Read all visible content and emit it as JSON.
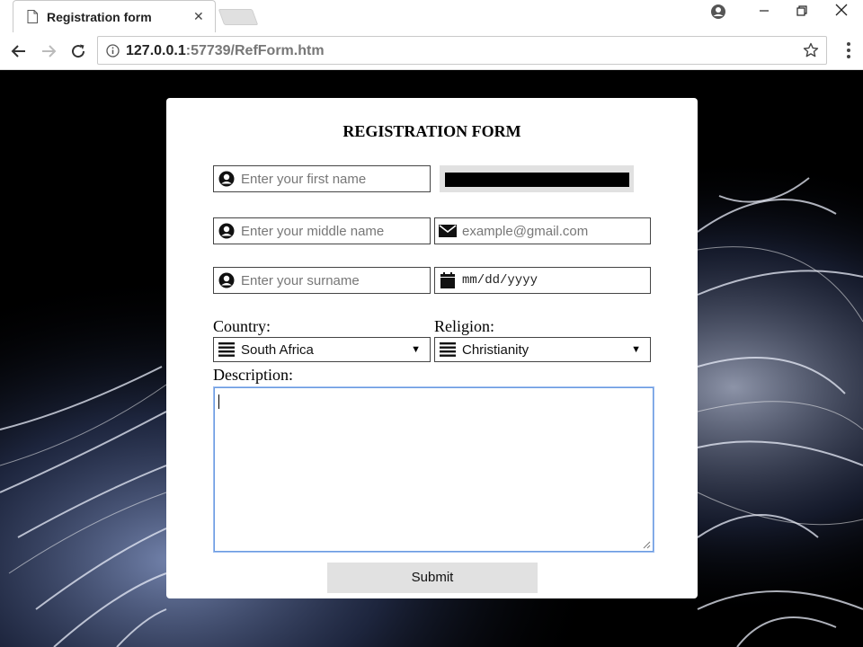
{
  "browser": {
    "tab_title": "Registration form",
    "url_host": "127.0.0.1",
    "url_rest": ":57739/RefForm.htm"
  },
  "form": {
    "title": "REGISTRATION FORM",
    "first_name_placeholder": "Enter your first name",
    "middle_name_placeholder": "Enter your middle name",
    "surname_placeholder": "Enter your surname",
    "email_placeholder": "example@gmail.com",
    "date_placeholder": "mm/dd/yyyy",
    "country_label": "Country:",
    "country_value": "South Africa",
    "religion_label": "Religion:",
    "religion_value": "Christianity",
    "description_label": "Description:",
    "submit_label": "Submit"
  }
}
